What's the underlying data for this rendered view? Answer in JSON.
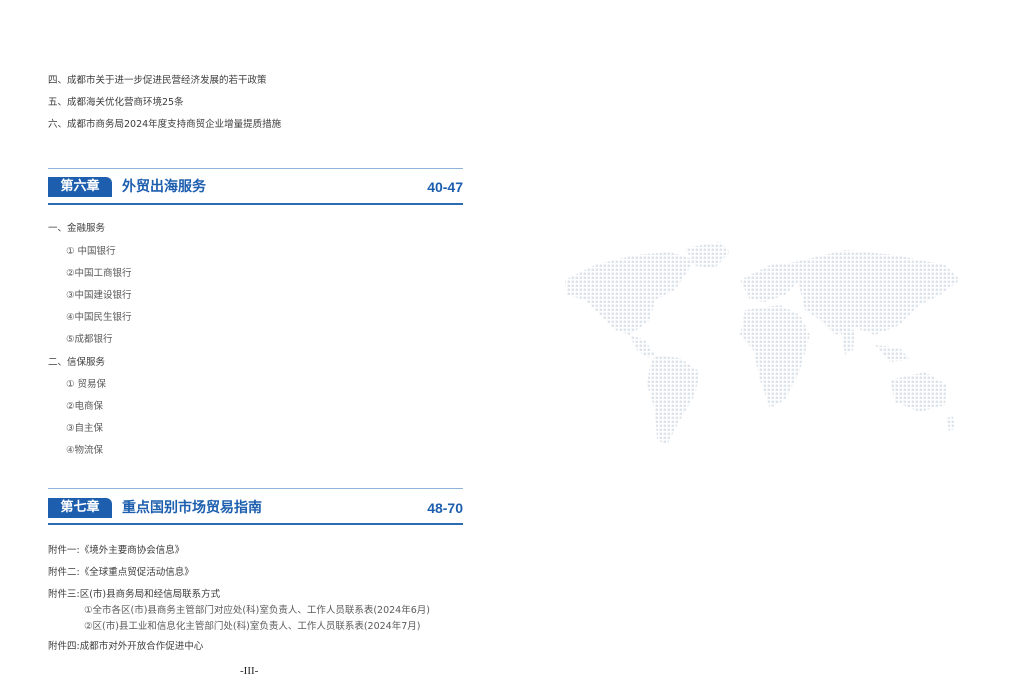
{
  "top_list": [
    "四、成都市关于进一步促进民营经济发展的若干政策",
    "五、成都海关优化营商环境25条",
    "六、成都市商务局2024年度支持商贸企业增量提质措施"
  ],
  "chapter6": {
    "badge": "第六章",
    "title": "外贸出海服务",
    "pages": "40-47",
    "sections": [
      {
        "heading": "一、金融服务",
        "items": [
          "① 中国银行",
          "②中国工商银行",
          "③中国建设银行",
          "④中国民生银行",
          "⑤成都银行"
        ]
      },
      {
        "heading": "二、信保服务",
        "items": [
          "① 贸易保",
          "②电商保",
          "③自主保",
          "④物流保"
        ]
      }
    ]
  },
  "chapter7": {
    "badge": "第七章",
    "title": "重点国别市场贸易指南",
    "pages": "48-70",
    "appendices": [
      "附件一:《境外主要商协会信息》",
      "附件二:《全球重点贸促活动信息》",
      "附件三:区(市)县商务局和经信局联系方式"
    ],
    "appendix3_items": [
      "①全市各区(市)县商务主管部门对应处(科)室负责人、工作人员联系表(2024年6月)",
      "②区(市)县工业和信息化主管部门处(科)室负责人、工作人员联系表(2024年7月)"
    ],
    "appendix4": "附件四:成都市对外开放合作促进中心"
  },
  "footer": {
    "page_number": "-III-"
  },
  "colors": {
    "accent": "#1d5fae",
    "map_dots": "#dde3ea"
  },
  "icons": [
    "world-map-dotted"
  ]
}
